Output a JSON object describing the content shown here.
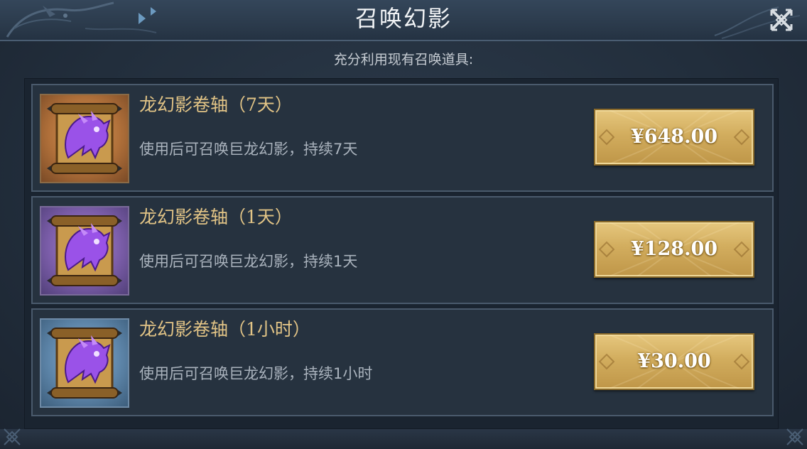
{
  "window": {
    "title": "召唤幻影",
    "subtitle": "充分利用现有召唤道具:"
  },
  "items": [
    {
      "name": "龙幻影卷轴（7天）",
      "description": "使用后可召唤巨龙幻影，持续7天",
      "price": "¥648.00",
      "icon": "dragon-scroll-icon",
      "frame_color": "#b0703a"
    },
    {
      "name": "龙幻影卷轴（1天）",
      "description": "使用后可召唤巨龙幻影，持续1天",
      "price": "¥128.00",
      "icon": "dragon-scroll-icon",
      "frame_color": "#7c5eaa"
    },
    {
      "name": "龙幻影卷轴（1小时）",
      "description": "使用后可召唤巨龙幻影，持续1小时",
      "price": "¥30.00",
      "icon": "dragon-scroll-icon",
      "frame_color": "#5e86aa"
    }
  ],
  "colors": {
    "title_text": "#f2f4f6",
    "item_name_text": "#e2c486",
    "description_text": "#aab3bd",
    "price_button": "#d2ad5e",
    "panel_background": "#26323f"
  },
  "icons": {
    "close": "close-icon"
  }
}
